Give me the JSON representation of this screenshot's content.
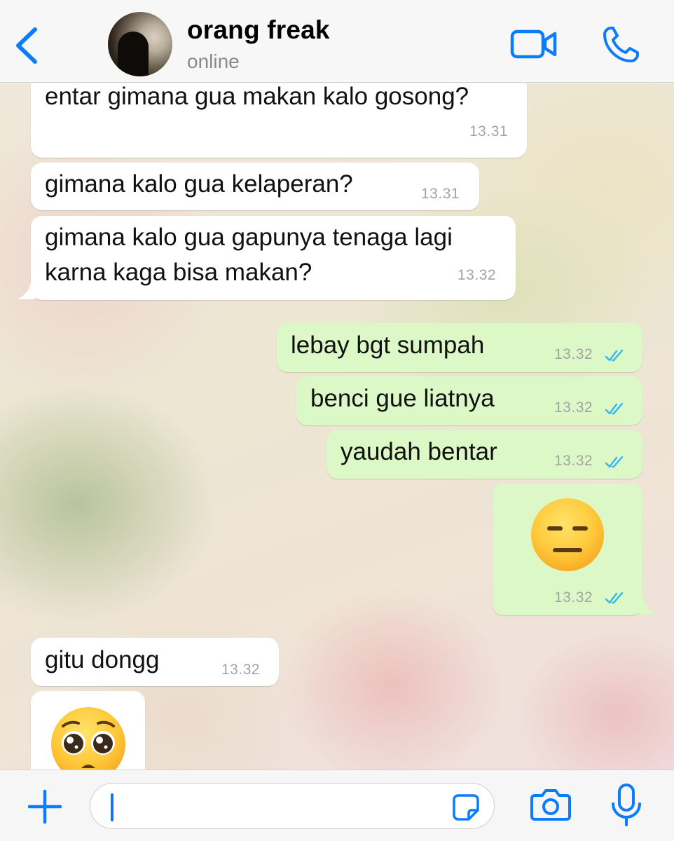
{
  "header": {
    "contact_name": "orang freak",
    "status": "online"
  },
  "icons": {
    "back": "chevron-left-icon",
    "video_call": "video-camera-icon",
    "voice_call": "phone-icon",
    "attach": "plus-icon",
    "sticker": "sticker-icon",
    "camera": "camera-icon",
    "microphone": "microphone-icon",
    "read_receipt": "double-check-icon"
  },
  "colors": {
    "accent": "#0a7cff",
    "incoming_bubble": "#ffffff",
    "outgoing_bubble": "#dcf8c6",
    "read_tick": "#34b7f1",
    "timestamp": "#a3a3a3"
  },
  "messages": [
    {
      "direction": "in",
      "text": "entar gimana gua makan kalo gosong?",
      "time": "13.31"
    },
    {
      "direction": "in",
      "text": "gimana kalo gua kelaperan?",
      "time": "13.31"
    },
    {
      "direction": "in",
      "text_line1": "gimana kalo gua gapunya tenaga lagi",
      "text_line2": "karna kaga bisa makan?",
      "time": "13.32"
    },
    {
      "direction": "out",
      "text": "lebay bgt sumpah",
      "time": "13.32",
      "read": true
    },
    {
      "direction": "out",
      "text": "benci gue liatnya",
      "time": "13.32",
      "read": true
    },
    {
      "direction": "out",
      "text": "yaudah bentar",
      "time": "13.32",
      "read": true
    },
    {
      "direction": "out",
      "emoji": "expressionless-face",
      "time": "13.32",
      "read": true
    },
    {
      "direction": "in",
      "text": "gitu dongg",
      "time": "13.32"
    },
    {
      "direction": "in",
      "emoji": "pleading-face"
    }
  ],
  "composer": {
    "input_value": "",
    "input_placeholder": ""
  }
}
